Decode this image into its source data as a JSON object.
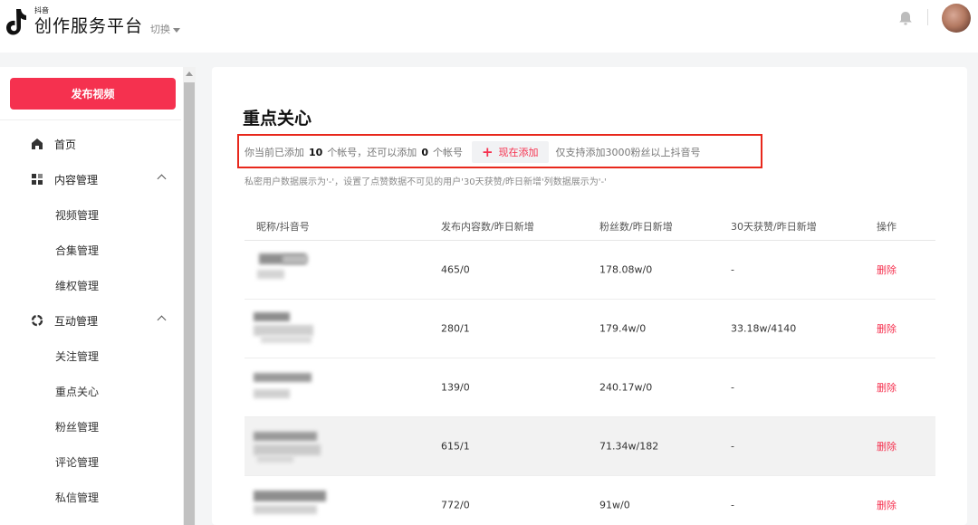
{
  "header": {
    "brand_small": "抖音",
    "brand": "创作服务平台",
    "switch_label": "切换"
  },
  "sidebar": {
    "publish_label": "发布视频",
    "items": [
      {
        "label": "首页"
      },
      {
        "label": "内容管理"
      },
      {
        "label": "视频管理"
      },
      {
        "label": "合集管理"
      },
      {
        "label": "维权管理"
      },
      {
        "label": "互动管理"
      },
      {
        "label": "关注管理"
      },
      {
        "label": "重点关心"
      },
      {
        "label": "粉丝管理"
      },
      {
        "label": "评论管理"
      },
      {
        "label": "私信管理"
      }
    ]
  },
  "main": {
    "title": "重点关心",
    "info": {
      "prefix": "你当前已添加",
      "added": "10",
      "mid": "个帐号，还可以添加",
      "remaining": "0",
      "suffix": "个帐号",
      "add_label": "现在添加",
      "requirement": "仅支持添加3000粉丝以上抖音号"
    },
    "note": "私密用户数据展示为'-'，设置了点赞数据不可见的用户'30天获赞/昨日新增'列数据展示为'-'",
    "table": {
      "headers": [
        "昵称/抖音号",
        "发布内容数/昨日新增",
        "粉丝数/昨日新增",
        "30天获赞/昨日新增",
        "操作"
      ],
      "delete_label": "删除",
      "rows": [
        {
          "posts": "465/0",
          "fans": "178.08w/0",
          "likes": "-"
        },
        {
          "posts": "280/1",
          "fans": "179.4w/0",
          "likes": "33.18w/4140"
        },
        {
          "posts": "139/0",
          "fans": "240.17w/0",
          "likes": "-"
        },
        {
          "posts": "615/1",
          "fans": "71.34w/182",
          "likes": "-"
        },
        {
          "posts": "772/0",
          "fans": "91w/0",
          "likes": "-"
        }
      ]
    }
  },
  "colors": {
    "accent": "#f5314f",
    "highlight_border": "#e8281c"
  }
}
